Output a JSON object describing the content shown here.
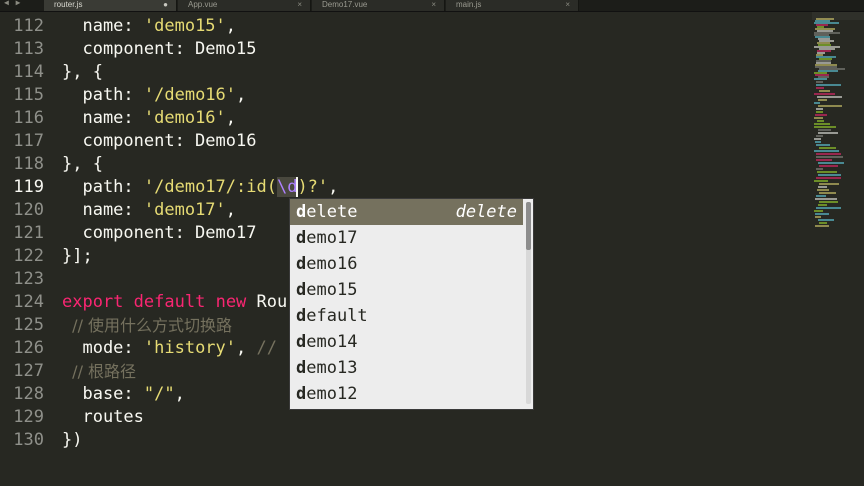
{
  "tabs": [
    {
      "label": "router.js",
      "active": true,
      "close": "●"
    },
    {
      "label": "App.vue",
      "active": false,
      "close": "×"
    },
    {
      "label": "Demo17.vue",
      "active": false,
      "close": "×"
    },
    {
      "label": "main.js",
      "active": false,
      "close": "×"
    }
  ],
  "nav_arrows": "◀ ▶",
  "editor": {
    "line_numbers": [
      "112",
      "113",
      "114",
      "115",
      "116",
      "117",
      "118",
      "119",
      "120",
      "121",
      "122",
      "123",
      "124",
      "125",
      "126",
      "127",
      "128",
      "129",
      "130"
    ],
    "current_line": "119",
    "lines": {
      "l112": {
        "a": "  name: ",
        "s": "'demo15'",
        "b": ","
      },
      "l113": {
        "a": "  component: Demo15"
      },
      "l114": {
        "a": "}, {"
      },
      "l115": {
        "a": "  path: ",
        "s": "'/demo16'",
        "b": ","
      },
      "l116": {
        "a": "  name: ",
        "s": "'demo16'",
        "b": ","
      },
      "l117": {
        "a": "  component: Demo16"
      },
      "l118": {
        "a": "}, {"
      },
      "l119": {
        "a": "  path: ",
        "s1": "'/demo17/:id(",
        "esc": "\\d",
        "s2": ")?'",
        "b": ","
      },
      "l120": {
        "a": "  name: ",
        "s": "'demo17'",
        "b": ","
      },
      "l121": {
        "a": "  component: Demo17"
      },
      "l122": {
        "a": "}];"
      },
      "l124": {
        "k1": "export",
        "k2": "default",
        "k3": "new",
        "a": " Rou"
      },
      "l125": {
        "c": "  // 使用什么方式切换路"
      },
      "l126": {
        "a": "  mode: ",
        "s": "'history'",
        "b": ", ",
        "c": "//"
      },
      "l127": {
        "c": "  // 根路径"
      },
      "l128": {
        "a": "  base: ",
        "s": "\"/\"",
        "b": ","
      },
      "l129": {
        "a": "  routes"
      },
      "l130": {
        "a": "})"
      }
    }
  },
  "autocomplete": {
    "typed": "d",
    "items": [
      {
        "rest": "elete",
        "hint": "delete",
        "selected": true
      },
      {
        "rest": "emo17",
        "hint": "",
        "selected": false
      },
      {
        "rest": "emo16",
        "hint": "",
        "selected": false
      },
      {
        "rest": "emo15",
        "hint": "",
        "selected": false
      },
      {
        "rest": "efault",
        "hint": "",
        "selected": false
      },
      {
        "rest": "emo14",
        "hint": "",
        "selected": false
      },
      {
        "rest": "emo13",
        "hint": "",
        "selected": false
      },
      {
        "rest": "emo12",
        "hint": "",
        "selected": false
      }
    ]
  },
  "colors": {
    "background": "#272822",
    "string": "#e6db74",
    "keyword": "#f92672",
    "comment": "#75715e",
    "selection": "#75715e"
  }
}
